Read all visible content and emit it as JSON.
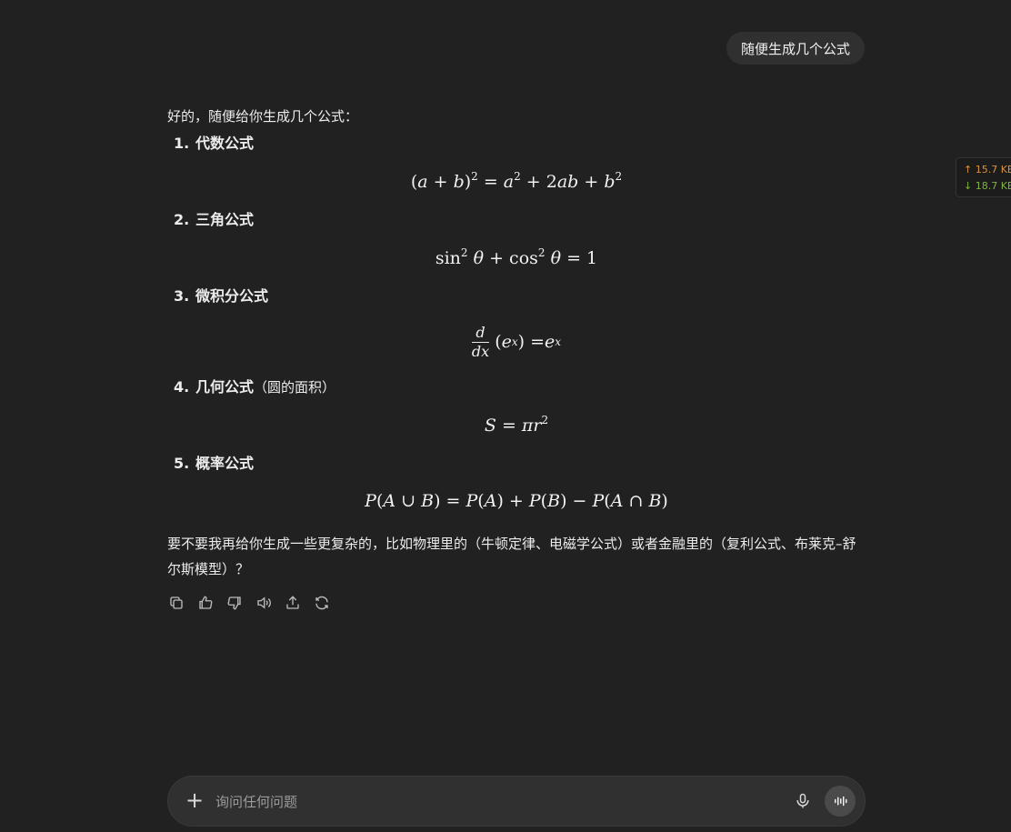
{
  "user_message": "随便生成几个公式",
  "assistant": {
    "intro": "好的，随便给你生成几个公式：",
    "items": [
      {
        "num": "1.",
        "title": "代数公式",
        "note": ""
      },
      {
        "num": "2.",
        "title": "三角公式",
        "note": ""
      },
      {
        "num": "3.",
        "title": "微积分公式",
        "note": ""
      },
      {
        "num": "4.",
        "title": "几何公式",
        "note": "（圆的面积）"
      },
      {
        "num": "5.",
        "title": "概率公式",
        "note": ""
      }
    ],
    "closing": "要不要我再给你生成一些更复杂的，比如物理里的（牛顿定律、电磁学公式）或者金融里的（复利公式、布莱克–舒尔斯模型）？"
  },
  "actions": [
    "copy-icon",
    "thumbs-up-icon",
    "thumbs-down-icon",
    "read-aloud-icon",
    "share-icon",
    "regenerate-icon"
  ],
  "net_widget": {
    "up": "↑ 15.7 KB",
    "down": "↓ 18.7 KB"
  },
  "composer": {
    "placeholder": "询问任何问题"
  }
}
